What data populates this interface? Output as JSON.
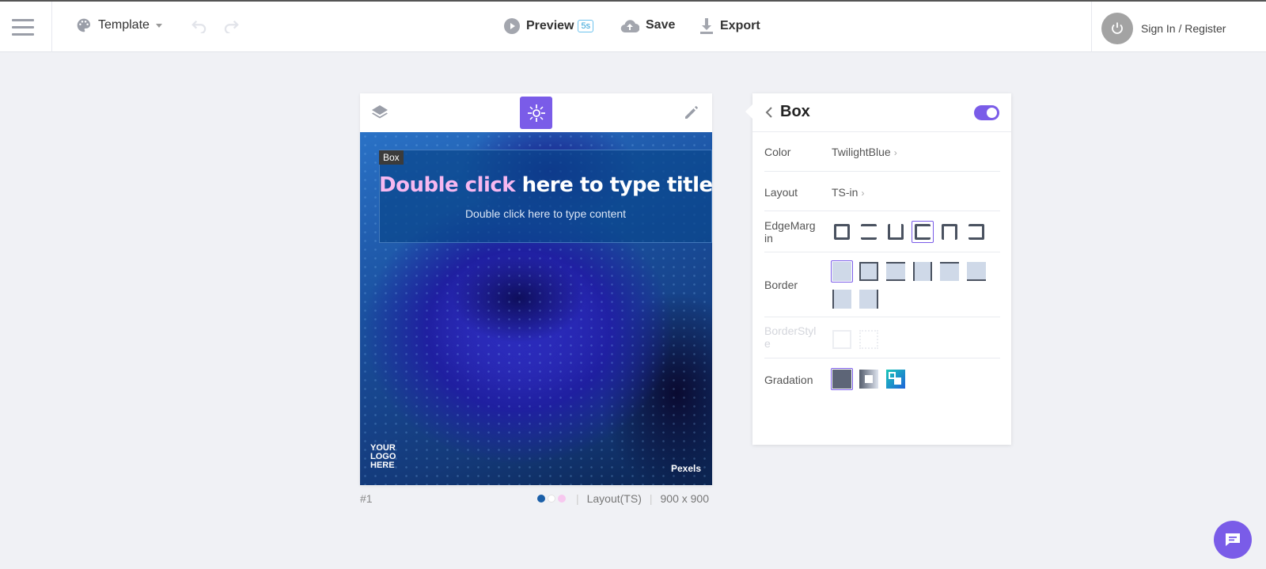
{
  "topbar": {
    "template_label": "Template",
    "preview_label": "Preview",
    "preview_badge": "5s",
    "save_label": "Save",
    "export_label": "Export",
    "signin_label": "Sign In / Register"
  },
  "canvas": {
    "box_tag": "Box",
    "title_highlight": "Double click",
    "title_rest": " here to type title text",
    "content": "Double click here to type content",
    "logo_line1": "YOUR",
    "logo_line2": "LOGO",
    "logo_line3": "HERE",
    "credit": "Pexels",
    "page_number": "#1",
    "layout_label": "Layout(TS)",
    "size_label": "900 x 900",
    "palette_dots": [
      "#1b5fa8",
      "#ffffff",
      "#f7c8ef"
    ]
  },
  "panel": {
    "title": "Box",
    "toggle_on": true,
    "color_label": "Color",
    "color_value": "TwilightBlue",
    "layout_label": "Layout",
    "layout_value": "TS-in",
    "edgemargin_label": "EdgeMargin",
    "border_label": "Border",
    "borderstyle_label": "BorderStyle",
    "gradation_label": "Gradation"
  },
  "colors": {
    "accent": "#7a5ce8",
    "title_highlight": "#f7b8f0"
  }
}
